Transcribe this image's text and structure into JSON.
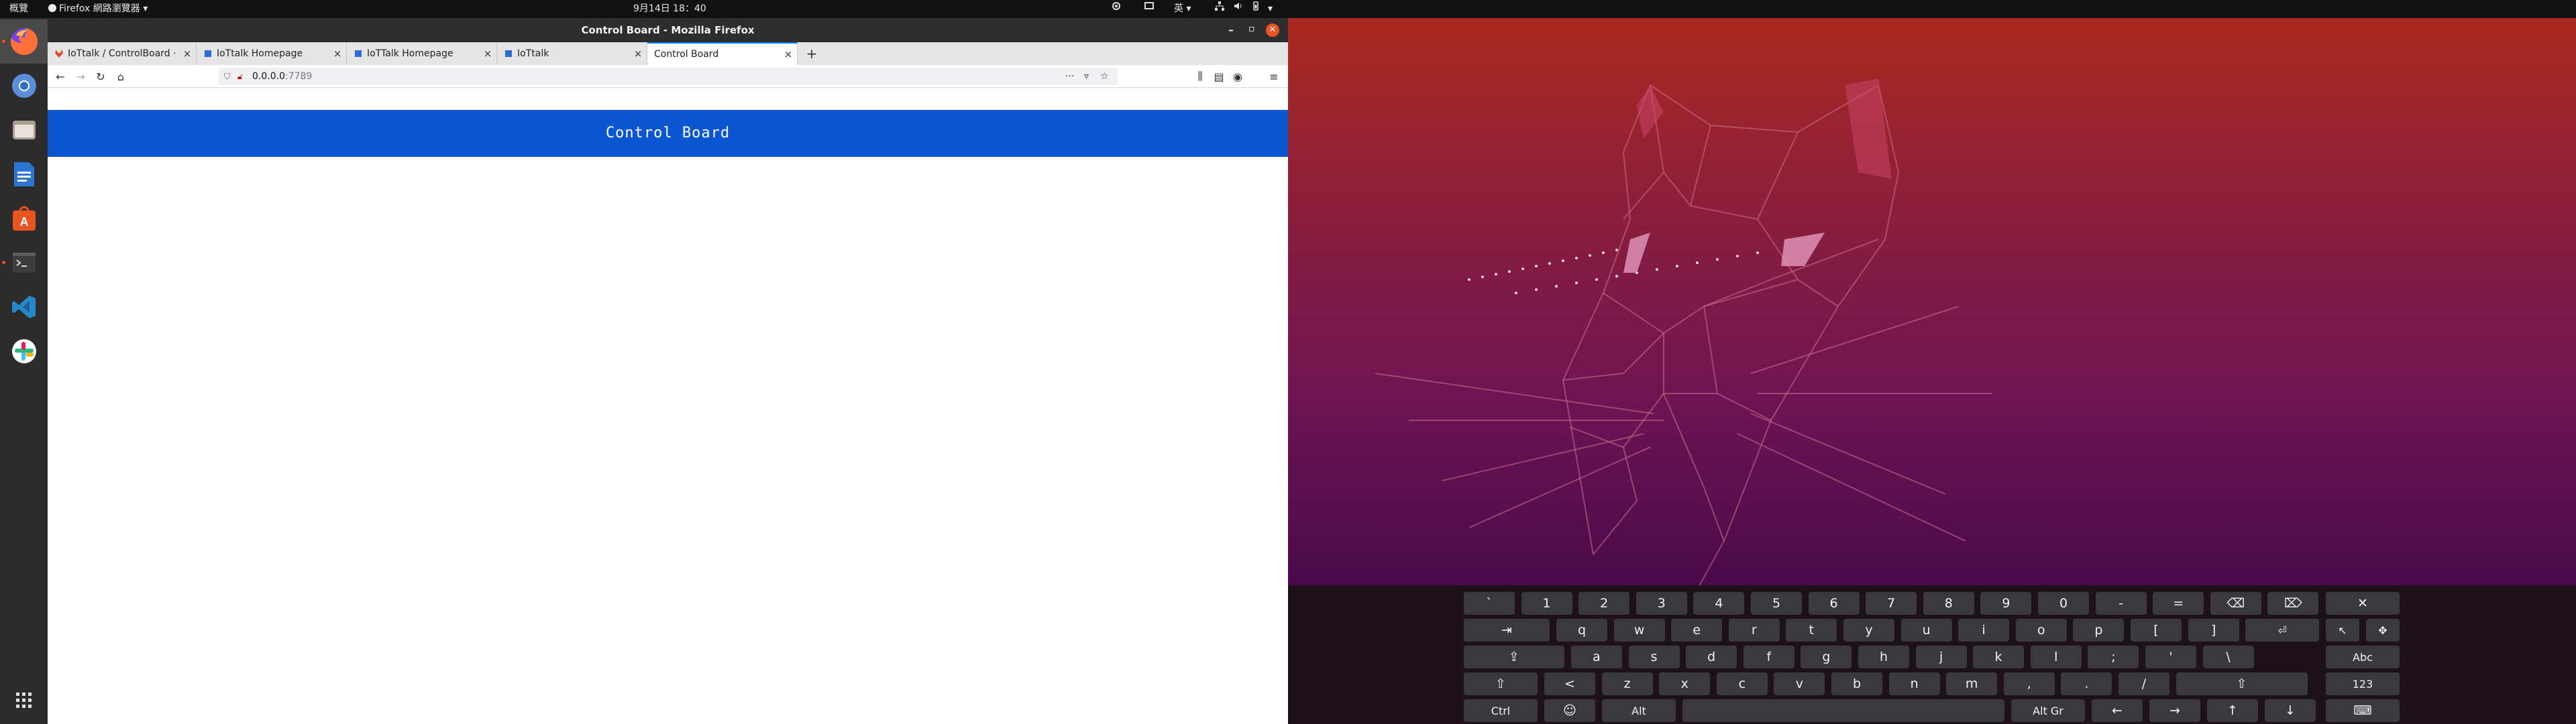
{
  "topbar": {
    "activities": "概覽",
    "app_menu": "Firefox 網路瀏覽器 ▾",
    "clock": "9月14日 18：40",
    "input_method": "英 ▾"
  },
  "dock": {
    "items": [
      "firefox-icon",
      "chromium-icon",
      "files-icon",
      "writer-icon",
      "software-icon",
      "terminal-icon",
      "vscode-icon",
      "slack-icon"
    ],
    "apps_grid": "show-applications-icon"
  },
  "window": {
    "title": "Control Board - Mozilla Firefox",
    "tabs": [
      {
        "label": "IoTtalk / ControlBoard · "
      },
      {
        "label": "IoTtalk Homepage"
      },
      {
        "label": "IoTTalk Homepage"
      },
      {
        "label": "IoTtalk"
      },
      {
        "label": "Control Board"
      }
    ],
    "url_host": "0.0.0.0",
    "url_port": ":7789"
  },
  "page": {
    "header_title": "Control Board"
  },
  "keyboard": {
    "row1": [
      "`",
      "1",
      "2",
      "3",
      "4",
      "5",
      "6",
      "7",
      "8",
      "9",
      "0",
      "-",
      "=",
      "⌫",
      "⌦",
      "✕"
    ],
    "row2": [
      "⇥",
      "q",
      "w",
      "e",
      "r",
      "t",
      "y",
      "u",
      "i",
      "o",
      "p",
      "[",
      "]",
      "⏎",
      "↖",
      "✥"
    ],
    "row3": [
      "⇪",
      "a",
      "s",
      "d",
      "f",
      "g",
      "h",
      "j",
      "k",
      "l",
      ";",
      "'",
      "\\",
      "Abc"
    ],
    "row4": [
      "⇧",
      "<",
      "z",
      "x",
      "c",
      "v",
      "b",
      "n",
      "m",
      ",",
      ".",
      "/",
      "⇧",
      "123"
    ],
    "row5": [
      "Ctrl",
      "☺",
      "Alt",
      "",
      "Alt Gr",
      "←",
      "→",
      "↑",
      "↓",
      "⌨"
    ]
  },
  "colors": {
    "page_header": "#0d56d1",
    "tab_accent": "#0a84ff",
    "ubuntu_orange": "#e95420"
  }
}
